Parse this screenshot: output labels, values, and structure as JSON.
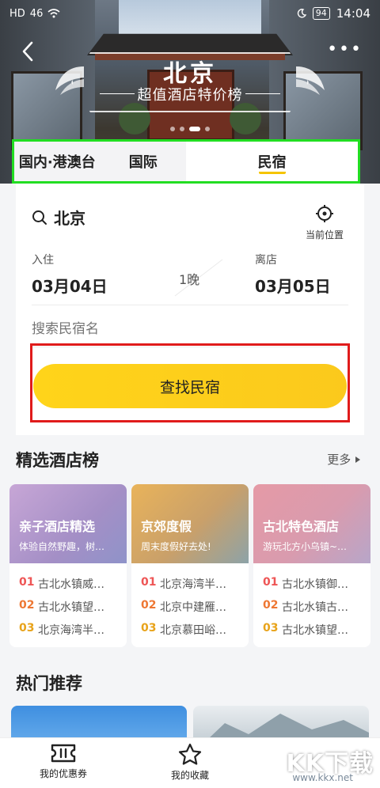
{
  "status_bar": {
    "carrier": "HD",
    "signal": "46",
    "battery": "94",
    "time": "14:04"
  },
  "hero": {
    "city": "北京",
    "subtitle": "超值酒店特价榜",
    "more": "•••"
  },
  "tabs": [
    {
      "label": "国内·港澳台"
    },
    {
      "label": "国际"
    },
    {
      "label": "民宿"
    }
  ],
  "search": {
    "city": "北京",
    "locate_label": "当前位置",
    "checkin_label": "入住",
    "checkin_date": "03月04日",
    "nights": "1晚",
    "checkout_label": "离店",
    "checkout_date": "03月05日",
    "keyword_placeholder": "搜索民宿名",
    "search_button": "查找民宿"
  },
  "featured": {
    "title": "精选酒店榜",
    "more": "更多",
    "cards": [
      {
        "title": "亲子酒店精选",
        "subtitle": "体验自然野趣，树…",
        "items": [
          {
            "rank": "01",
            "name": "古北水镇威…"
          },
          {
            "rank": "02",
            "name": "古北水镇望…"
          },
          {
            "rank": "03",
            "name": "北京海湾半…"
          }
        ]
      },
      {
        "title": "京郊度假",
        "subtitle": "周末度假好去处!",
        "items": [
          {
            "rank": "01",
            "name": "北京海湾半…"
          },
          {
            "rank": "02",
            "name": "北京中建雁…"
          },
          {
            "rank": "03",
            "name": "北京慕田峪…"
          }
        ]
      },
      {
        "title": "古北特色酒店",
        "subtitle": "游玩北方小乌镇~…",
        "items": [
          {
            "rank": "01",
            "name": "古北水镇御…"
          },
          {
            "rank": "02",
            "name": "古北水镇古…"
          },
          {
            "rank": "03",
            "name": "古北水镇望…"
          }
        ]
      }
    ]
  },
  "recommend": {
    "title": "热门推荐"
  },
  "bottom_nav": [
    {
      "label": "我的优惠券"
    },
    {
      "label": "我的收藏"
    }
  ],
  "watermark": {
    "logo": "KK下载",
    "url": "www.kkx.net"
  },
  "colors": {
    "accent_yellow": "#ffd41a",
    "highlight_green": "#22dd22",
    "highlight_red": "#e01b1b"
  }
}
